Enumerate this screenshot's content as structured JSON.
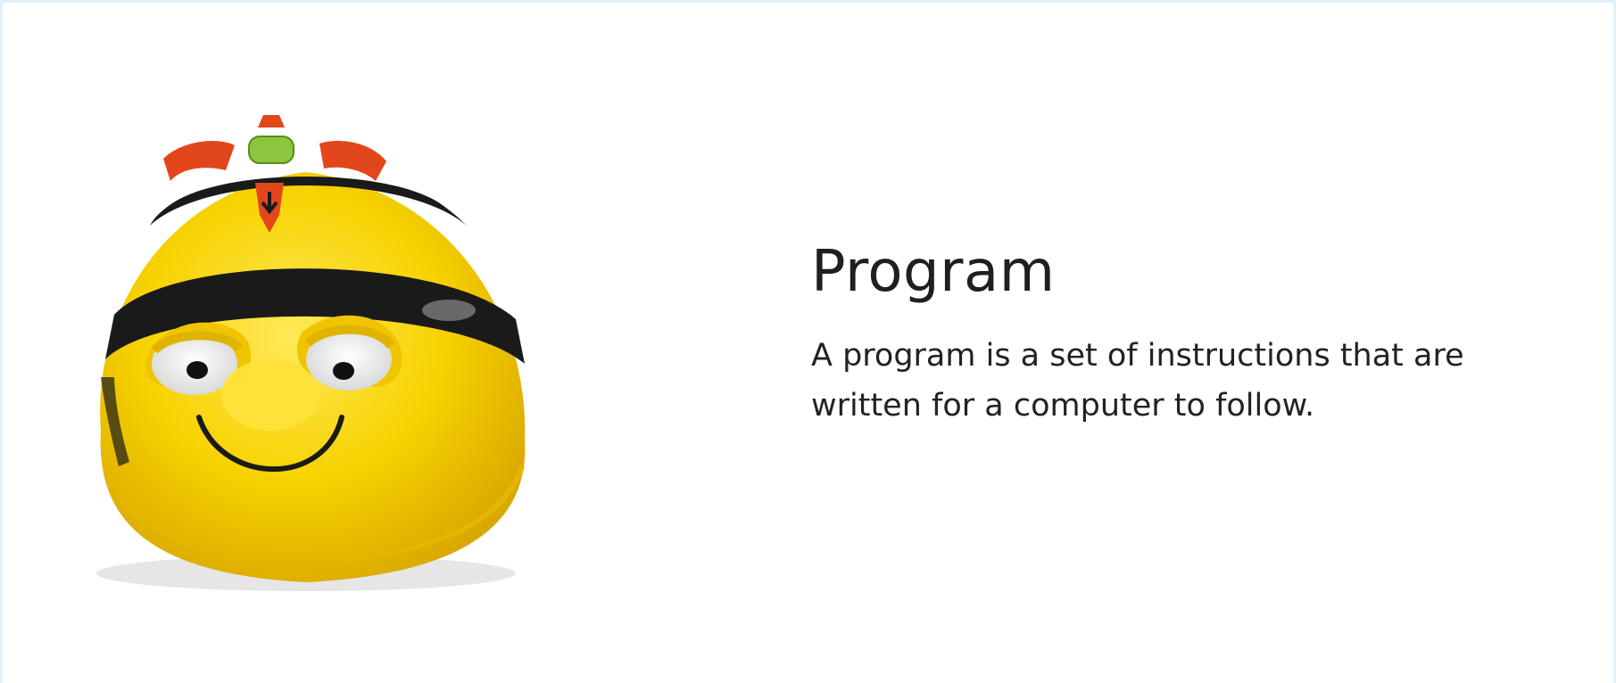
{
  "card": {
    "title": "Program",
    "description": "A program is a set of instructions that are written for a computer to follow."
  },
  "image": {
    "icon": "bee-bot-robot",
    "colors": {
      "body": "#f7d200",
      "stripe": "#1a1a1a",
      "buttons": "#e2471b",
      "go_button": "#8cc63f"
    }
  },
  "colors": {
    "border": "#dff1f8",
    "text": "#1f1f1f"
  }
}
